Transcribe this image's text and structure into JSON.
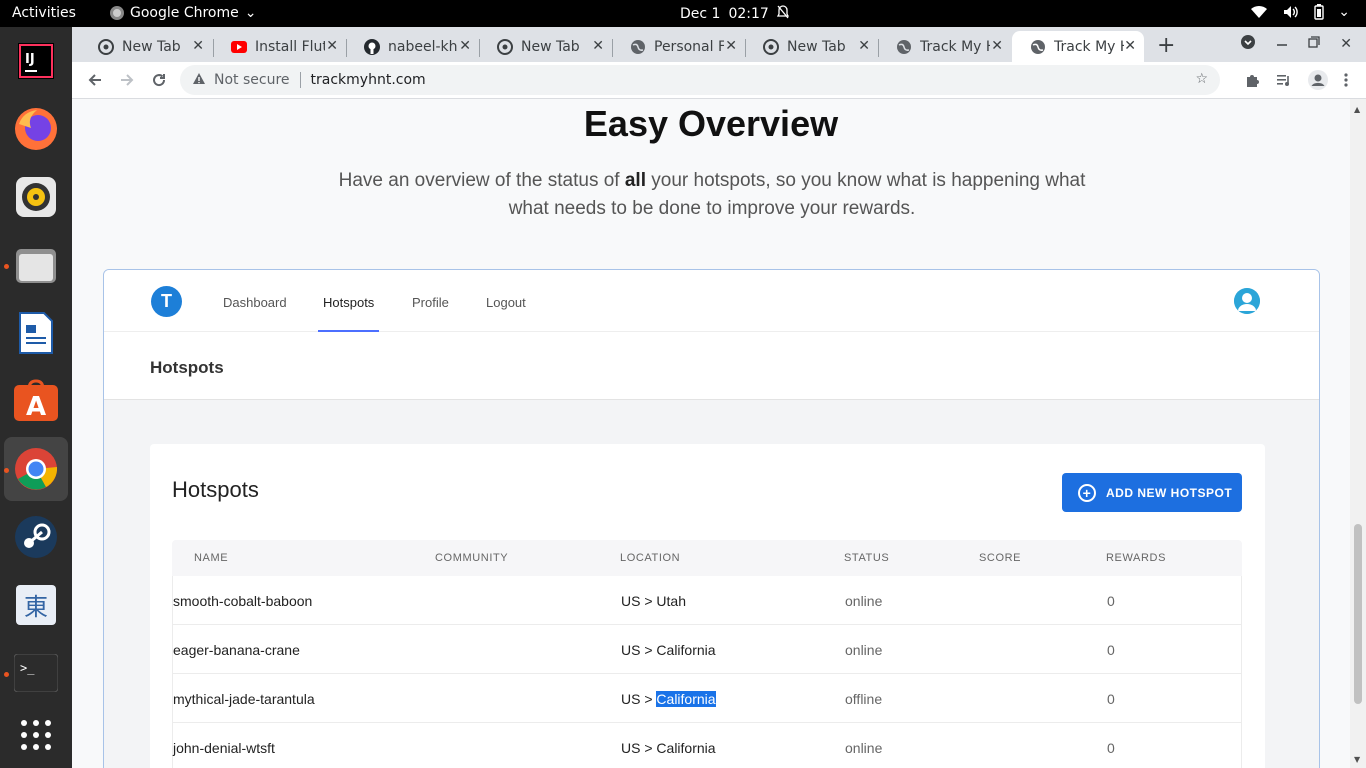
{
  "system": {
    "activities": "Activities",
    "app_name": "Google Chrome",
    "date": "Dec 1",
    "time": "02:17"
  },
  "tabs": [
    {
      "title": "New Tab",
      "icon": "chrome-icon"
    },
    {
      "title": "Install Flut",
      "icon": "youtube-icon"
    },
    {
      "title": "nabeel-kh",
      "icon": "github-icon"
    },
    {
      "title": "New Tab",
      "icon": "chrome-icon"
    },
    {
      "title": "Personal F",
      "icon": "globe-icon"
    },
    {
      "title": "New Tab",
      "icon": "chrome-icon"
    },
    {
      "title": "Track My H",
      "icon": "globe-icon"
    },
    {
      "title": "Track My H",
      "icon": "globe-icon",
      "active": true
    }
  ],
  "address_bar": {
    "security": "Not secure",
    "url": "trackmyhnt.com"
  },
  "page": {
    "headline": "Easy Overview",
    "sub_before": "Have an overview of the status of ",
    "sub_bold": "all",
    "sub_after": " your hotspots, so you know what is happening what what needs to be done to improve your rewards."
  },
  "app": {
    "logo_letter": "T",
    "nav": [
      "Dashboard",
      "Hotspots",
      "Profile",
      "Logout"
    ],
    "active_nav": "Hotspots",
    "page_title": "Hotspots",
    "card_title": "Hotspots",
    "add_button": "ADD NEW HOTSPOT",
    "columns": [
      "NAME",
      "COMMUNITY",
      "LOCATION",
      "STATUS",
      "SCORE",
      "REWARDS"
    ],
    "rows": [
      {
        "name": "smooth-cobalt-baboon",
        "community": "",
        "loc_country": "US",
        "loc_sep": " > ",
        "loc_region": "Utah",
        "status": "online",
        "score": "",
        "rewards": "0"
      },
      {
        "name": "eager-banana-crane",
        "community": "",
        "loc_country": "US",
        "loc_sep": " > ",
        "loc_region": "California",
        "status": "online",
        "score": "",
        "rewards": "0"
      },
      {
        "name": "mythical-jade-tarantula",
        "community": "",
        "loc_country": "US",
        "loc_sep": " > ",
        "loc_region": "California",
        "status": "offline",
        "score": "",
        "rewards": "0",
        "selected_text": "California"
      },
      {
        "name": "john-denial-wtsft",
        "community": "",
        "loc_country": "US",
        "loc_sep": " > ",
        "loc_region": "California",
        "status": "online",
        "score": "",
        "rewards": "0"
      }
    ]
  },
  "colors": {
    "accent": "#1d6fe0",
    "logo": "#1d7fd8",
    "nav_underline": "#4c6fff",
    "selection": "#1a73e8"
  }
}
